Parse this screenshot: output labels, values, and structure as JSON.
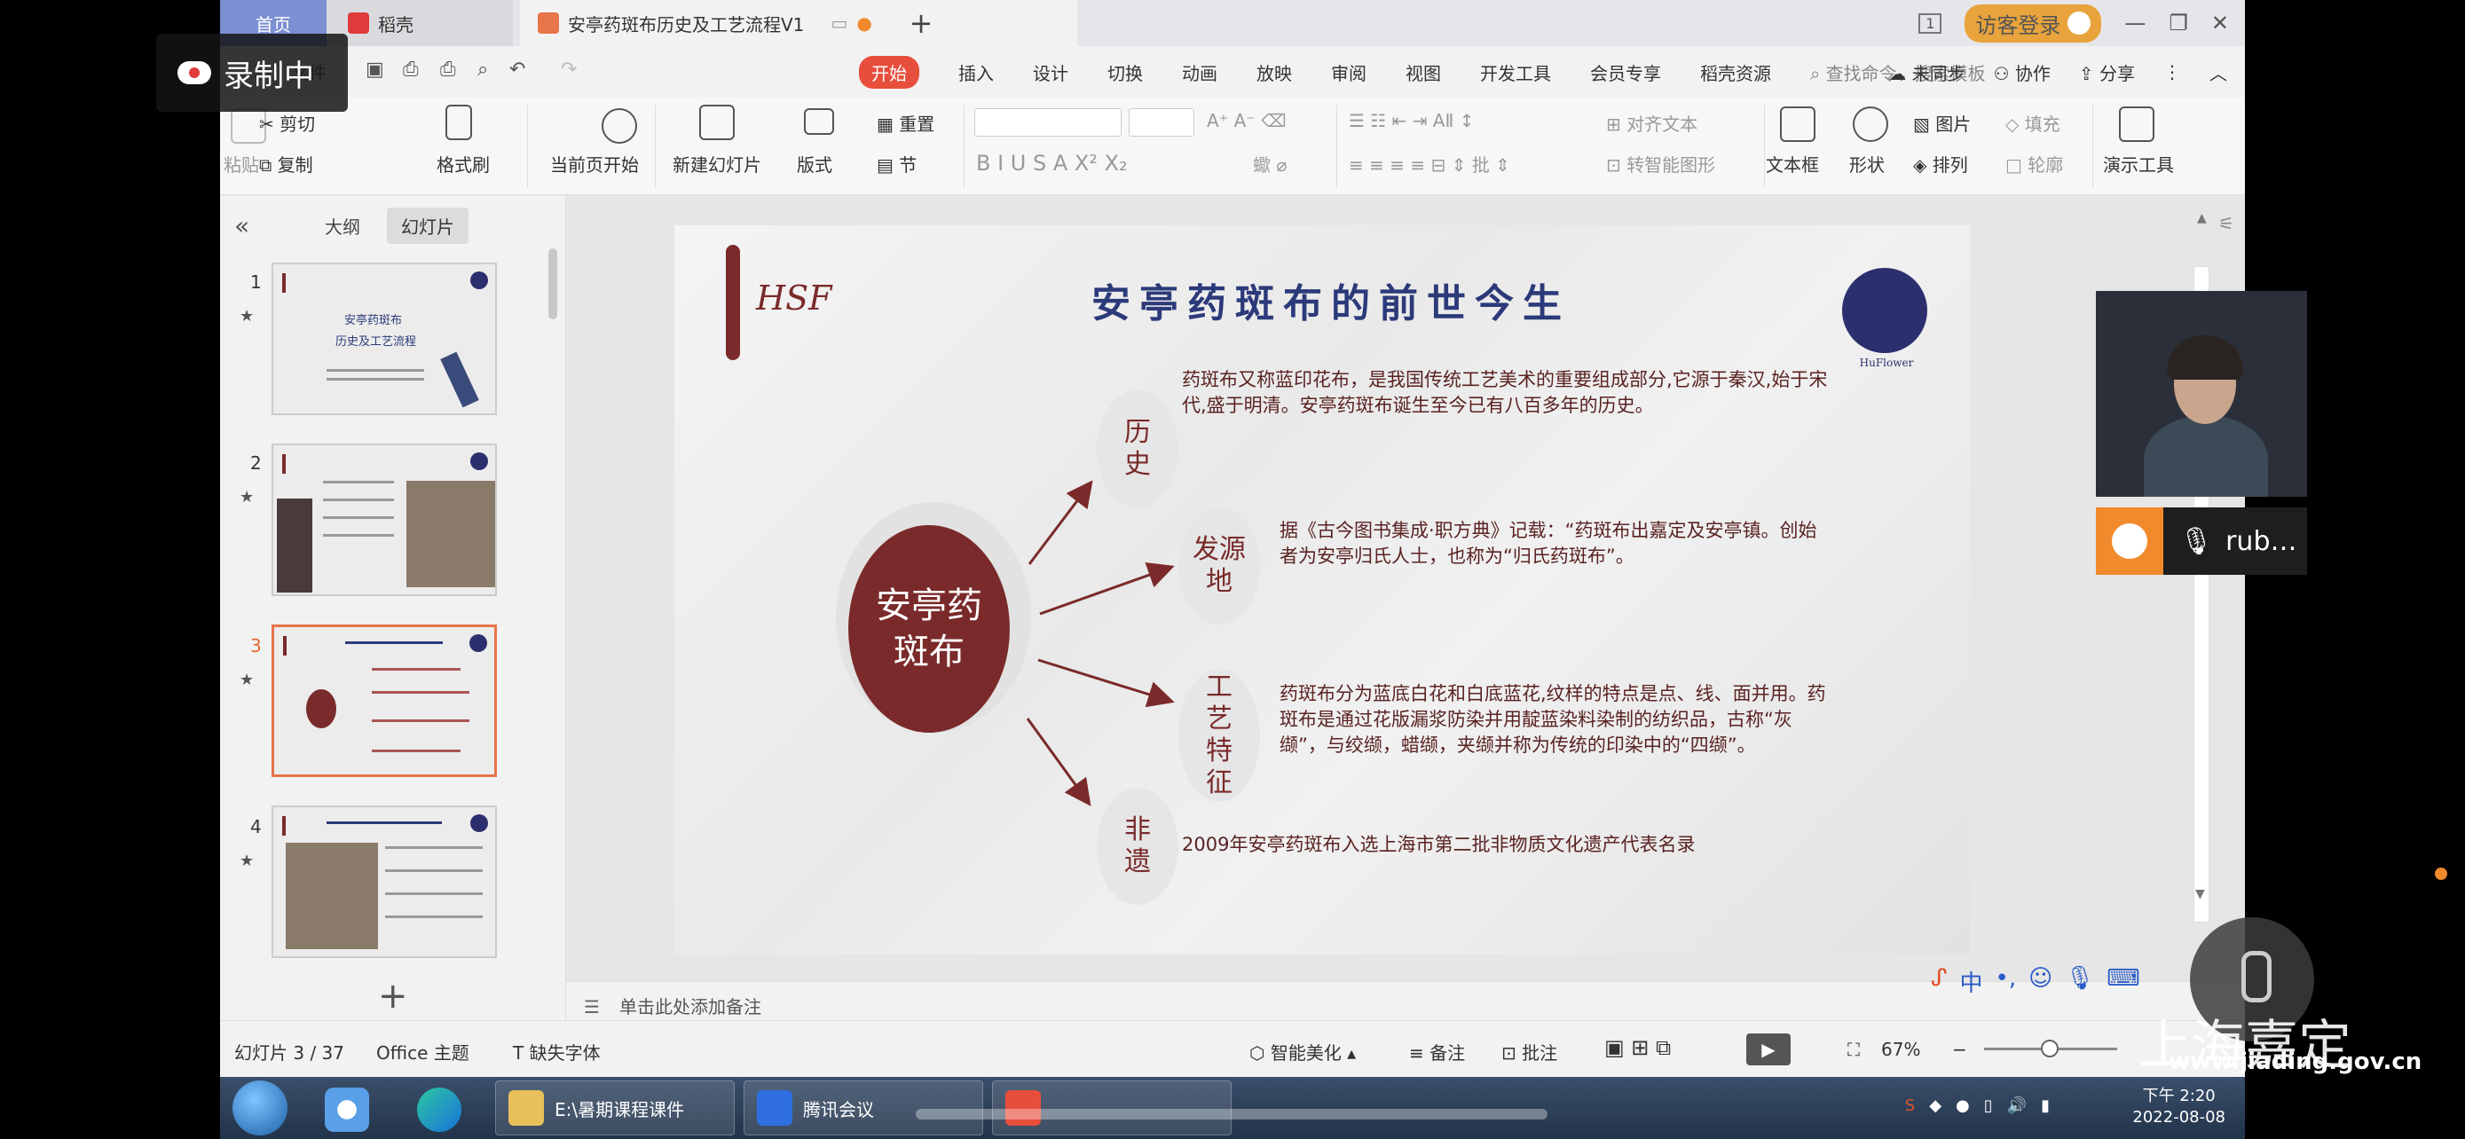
{
  "tabs": {
    "home": "首页",
    "store": "稻壳",
    "doc": "安亭药斑布历史及工艺流程V1",
    "add": "+"
  },
  "window": {
    "visitor_login": "访客登录",
    "badge": "1"
  },
  "menu": {
    "items": [
      "开始",
      "插入",
      "设计",
      "切换",
      "动画",
      "放映",
      "审阅",
      "视图",
      "开发工具",
      "会员专享",
      "稻壳资源"
    ],
    "active": "开始",
    "search": "查找命令、搜索模板",
    "unsynced": "未同步",
    "collab": "协作",
    "share": "分享"
  },
  "ribbon": {
    "paste": "粘贴",
    "cut": "剪切",
    "copy": "复制",
    "format_painter": "格式刷",
    "from_current": "当前页开始",
    "new_slide": "新建幻灯片",
    "layout": "版式",
    "section": "节",
    "reset": "重置",
    "align_text": "对齐文本",
    "to_smartart": "转智能图形",
    "textbox": "文本框",
    "shape": "形状",
    "picture": "图片",
    "arrange": "排列",
    "fill": "填充",
    "outline": "轮廓",
    "present_tools": "演示工具"
  },
  "panel": {
    "outline_tab": "大纲",
    "slides_tab": "幻灯片",
    "thumbnails": [
      {
        "num": "1",
        "title": "安亭药斑布",
        "subtitle": "历史及工艺流程"
      },
      {
        "num": "2"
      },
      {
        "num": "3"
      },
      {
        "num": "4"
      }
    ],
    "add": "+"
  },
  "slide": {
    "title": "安亭药斑布的前世今生",
    "logo_text": "HuFlower",
    "mark": "HSF",
    "center": "安亭药斑布",
    "nodes": [
      {
        "label": "历史",
        "desc": "药斑布又称蓝印花布，是我国传统工艺美术的重要组成部分,它源于秦汉,始于宋代,盛于明清。安亭药斑布诞生至今已有八百多年的历史。"
      },
      {
        "label": "发源地",
        "desc": "据《古今图书集成·职方典》记载：“药斑布出嘉定及安亭镇。创始者为安亭归氏人士，也称为“归氏药斑布”。"
      },
      {
        "label": "工艺特征",
        "desc": "药斑布分为蓝底白花和白底蓝花,纹样的特点是点、线、面并用。药斑布是通过花版漏浆防染并用靛蓝染料染制的纺织品，古称“灰缬”，与绞缬，蜡缬，夹缬并称为传统的印染中的“四缬”。"
      },
      {
        "label": "非遗",
        "desc": "2009年安亭药斑布入选上海市第二批非物质文化遗产代表名录"
      }
    ]
  },
  "notes": {
    "placeholder": "单击此处添加备注"
  },
  "status": {
    "slide_count": "幻灯片 3 / 37",
    "theme": "Office 主题",
    "missing_font": "缺失字体",
    "smart_beautify": "智能美化",
    "notes": "备注",
    "comment": "批注",
    "zoom": "67%"
  },
  "overlay": {
    "recording": "录制中",
    "participant": "rub…",
    "watermark": "上海嘉定",
    "watermark_url": "www.jiading.gov.cn"
  },
  "taskbar": {
    "explorer": "E:\\暑期课程课件",
    "meeting": "腾讯会议",
    "clock_time": "下午 2:20",
    "clock_date": "2022-08-08"
  },
  "colors": {
    "accent": "#7a2a2a",
    "title_blue": "#2c3a7a",
    "active_menu": "#e84e3c"
  }
}
